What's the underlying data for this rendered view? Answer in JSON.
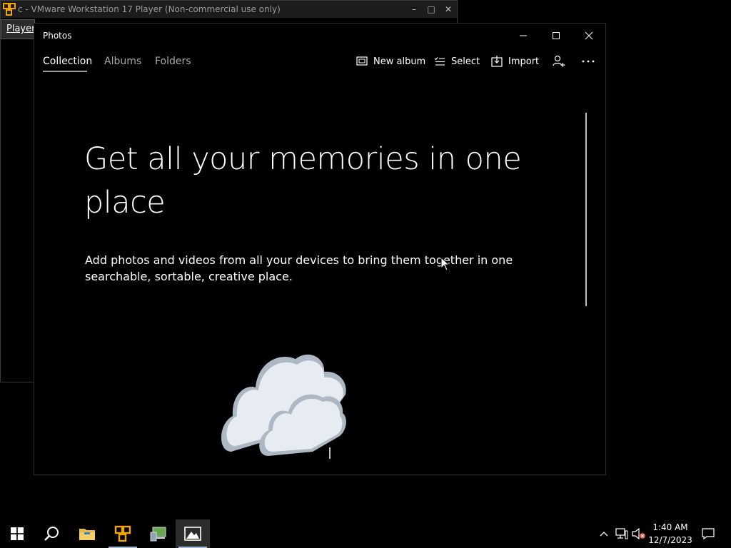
{
  "vmware": {
    "title": "c - VMware Workstation 17 Player (Non-commercial use only)",
    "menu_label": "Player"
  },
  "photos": {
    "window_title": "Photos",
    "tabs": [
      {
        "label": "Collection",
        "active": true
      },
      {
        "label": "Albums",
        "active": false
      },
      {
        "label": "Folders",
        "active": false
      }
    ],
    "toolbar": {
      "new_album": "New album",
      "select": "Select",
      "import": "Import"
    },
    "headline": "Get all your memories in one place",
    "subtext": "Add photos and videos from all your devices to bring them together in one searchable, sortable, creative place."
  },
  "taskbar": {
    "apps": [
      {
        "icon": "windows-start-icon"
      },
      {
        "icon": "search-icon"
      },
      {
        "icon": "file-explorer-icon"
      },
      {
        "icon": "vmware-icon"
      },
      {
        "icon": "server-manager-icon"
      },
      {
        "icon": "photos-icon",
        "active": true
      }
    ],
    "time": "1:40 AM",
    "date": "12/7/2023"
  },
  "colors": {
    "background": "#000000",
    "text": "#ffffff",
    "muted_text": "#a8a8a8",
    "cloud_fill": "#e6ecf2",
    "cloud_shade": "#aeb8c4"
  }
}
